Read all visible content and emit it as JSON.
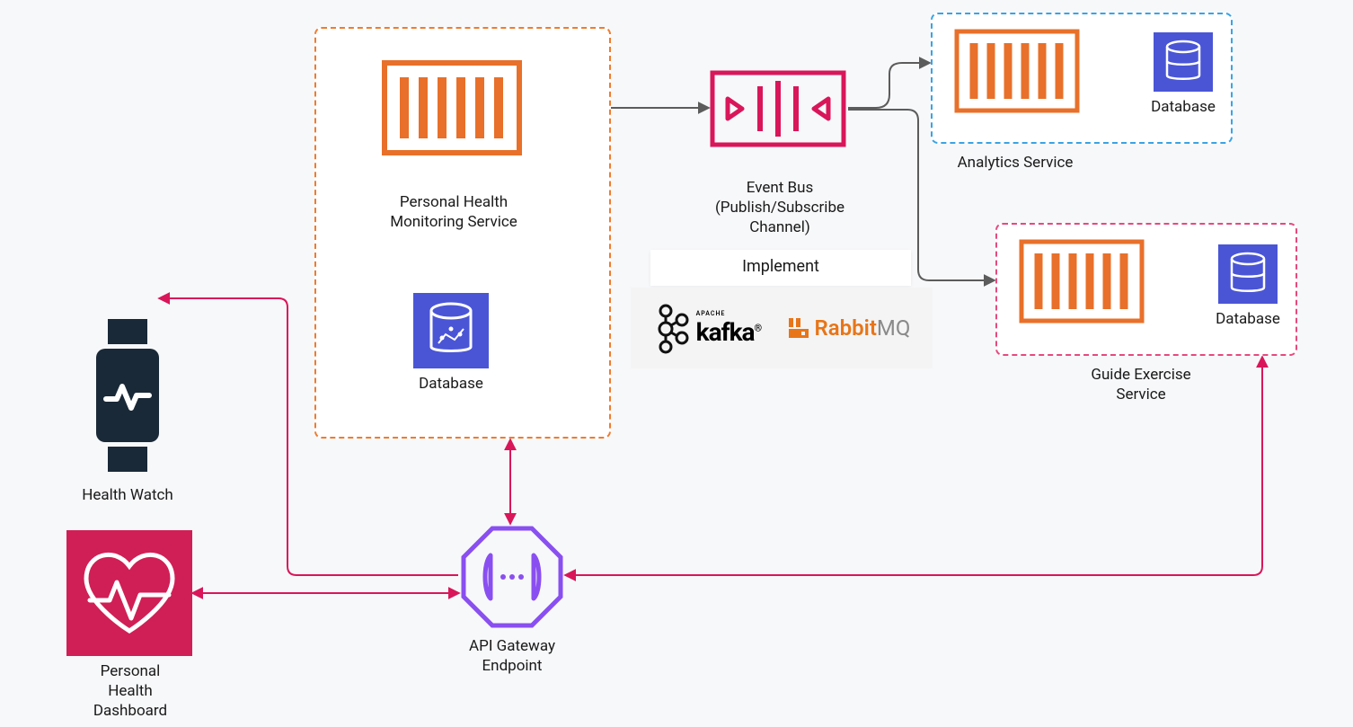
{
  "nodes": {
    "health_watch": {
      "label": "Health Watch"
    },
    "dashboard": {
      "label": "Personal\nHealth\nDashboard"
    },
    "api_gateway": {
      "label": "API Gateway\nEndpoint"
    },
    "phm_service": {
      "label": "Personal Health\nMonitoring Service"
    },
    "phm_db": {
      "label": "Database"
    },
    "event_bus": {
      "label": "Event Bus\n(Publish/Subscribe\nChannel)"
    },
    "implement": {
      "label": "Implement"
    },
    "kafka": {
      "label": "kafka"
    },
    "kafka_sub": {
      "label": "APACHE"
    },
    "rabbitmq_brand": {
      "label": "Rabbit"
    },
    "rabbitmq_suffix": {
      "label": "MQ"
    },
    "analytics": {
      "label": "Analytics Service"
    },
    "analytics_db": {
      "label": "Database"
    },
    "guide": {
      "label": "Guide Exercise\nService"
    },
    "guide_db": {
      "label": "Database"
    }
  },
  "colors": {
    "orange": "#e8702a",
    "orange_dash": "#f07b2e",
    "blue_dash": "#3aa3e3",
    "pink_dash": "#e6497d",
    "magenta": "#d9165a",
    "purple": "#8a4ff0",
    "navy": "#1a2938",
    "dashboard_bg": "#d01f56",
    "db_blue": "#4a55d6",
    "red_conn": "#d9165a",
    "grey_conn": "#5c5c5c",
    "rabbit_orange": "#e87518",
    "rabbit_grey": "#8a8a8a"
  }
}
